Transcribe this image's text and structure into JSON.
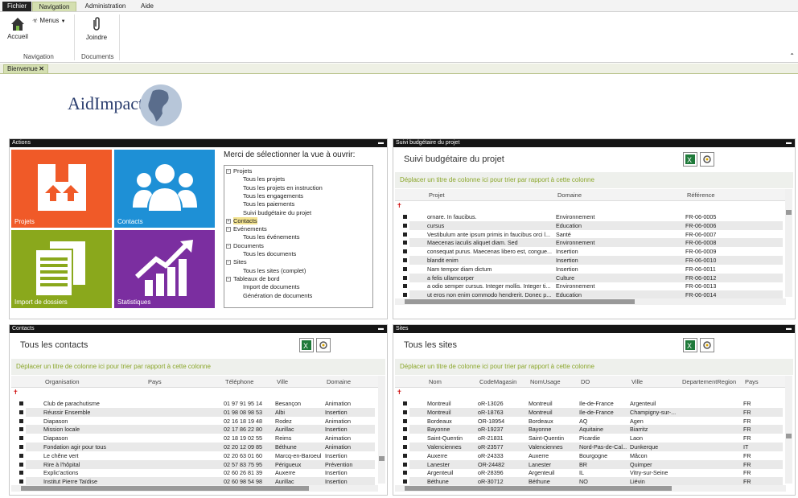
{
  "menu": {
    "file": "Fichier",
    "navigation": "Navigation",
    "administration": "Administration",
    "help": "Aide"
  },
  "ribbon": {
    "home": "Accueil",
    "menus": "Menus",
    "group_navigation": "Navigation",
    "attach": "Joindre",
    "group_documents": "Documents"
  },
  "doc_tab": {
    "label": "Bienvenue"
  },
  "logo": {
    "text": "AidImpact"
  },
  "actions": {
    "title": "Actions",
    "tiles": {
      "projects": "Projets",
      "contacts": "Contacts",
      "import": "Import de dossiers",
      "stats": "Statistiques"
    },
    "prompt": "Merci de sélectionner la vue à ouvrir:",
    "tree": [
      {
        "label": "Projets",
        "level": 0,
        "expand": "−"
      },
      {
        "label": "Tous les projets",
        "level": 1
      },
      {
        "label": "Tous les projets en instruction",
        "level": 1
      },
      {
        "label": "Tous les engagements",
        "level": 1
      },
      {
        "label": "Tous les paiements",
        "level": 1
      },
      {
        "label": "Suivi budgétaire du projet",
        "level": 1
      },
      {
        "label": "Contacts",
        "level": 0,
        "expand": "+",
        "selected": true
      },
      {
        "label": "Evénements",
        "level": 0,
        "expand": "−"
      },
      {
        "label": "Tous les événements",
        "level": 1
      },
      {
        "label": "Documents",
        "level": 0,
        "expand": "−"
      },
      {
        "label": "Tous les documents",
        "level": 1
      },
      {
        "label": "Sites",
        "level": 0,
        "expand": "−"
      },
      {
        "label": "Tous les sites (complet)",
        "level": 1
      },
      {
        "label": "Tableaux de bord",
        "level": 0,
        "expand": "−"
      },
      {
        "label": "Import de documents",
        "level": 1
      },
      {
        "label": "Génération de documents",
        "level": 1
      }
    ]
  },
  "group_hint": "Déplacer un titre de colonne ici pour trier par rapport à cette colonne",
  "budget": {
    "header": "Suivi budgétaire du projet",
    "title": "Suivi budgétaire du projet",
    "columns": [
      "Projet",
      "Domaine",
      "Référence"
    ],
    "rows": [
      [
        "ornare. In faucibus.",
        "Environnement",
        "FR-06-0005"
      ],
      [
        "cursus",
        "Education",
        "FR-06-0006"
      ],
      [
        "Vestibulum ante ipsum primis in faucibus orci l...",
        "Santé",
        "FR-06-0007"
      ],
      [
        "Maecenas iaculis aliquet diam. Sed",
        "Environnement",
        "FR-06-0008"
      ],
      [
        "consequat purus. Maecenas libero est, congue...",
        "Insertion",
        "FR-06-0009"
      ],
      [
        "blandit enim",
        "Insertion",
        "FR-06-0010"
      ],
      [
        "Nam tempor diam dictum",
        "Insertion",
        "FR-06-0011"
      ],
      [
        "a felis ullamcorper",
        "Culture",
        "FR-06-0012"
      ],
      [
        "a odio semper cursus. Integer mollis. Integer ti...",
        "Environnement",
        "FR-06-0013"
      ],
      [
        "ut eros non enim commodo hendrerit. Donec p...",
        "Education",
        "FR-06-0014"
      ]
    ]
  },
  "contacts": {
    "header": "Contacts",
    "title": "Tous les contacts",
    "columns": [
      "Organisation",
      "Pays",
      "Téléphone",
      "Ville",
      "Domaine"
    ],
    "rows": [
      [
        "Club de parachutisme",
        "",
        "01 97 91 95 14",
        "Besançon",
        "Animation"
      ],
      [
        "Réussir Ensemble",
        "",
        "01 98 08 98 53",
        "Albi",
        "Insertion"
      ],
      [
        "Diapason",
        "",
        "02 16 18 19 48",
        "Rodez",
        "Animation"
      ],
      [
        "Mission locale",
        "",
        "02 17 86 22 80",
        "Aurillac",
        "Insertion"
      ],
      [
        "Diapason",
        "",
        "02 18 19 02 55",
        "Reims",
        "Animation"
      ],
      [
        "Fondation agir pour tous",
        "",
        "02 20 12 09 85",
        "Béthune",
        "Animation"
      ],
      [
        "Le chêne vert",
        "",
        "02 20 63 01 60",
        "Marcq-en-Baroeul",
        "Insertion"
      ],
      [
        "Rire à l'hôpital",
        "",
        "02 57 83 75 95",
        "Périgueux",
        "Prévention"
      ],
      [
        "Explic'actions",
        "",
        "02 60 26 81 39",
        "Auxerre",
        "Insertion"
      ],
      [
        "Institut Pierre Taïdise",
        "",
        "02 60 98 54 98",
        "Aurillac",
        "Insertion"
      ]
    ]
  },
  "sites": {
    "header": "Sites",
    "title": "Tous les sites",
    "columns": [
      "Nom",
      "CodeMagasin",
      "NomUsage",
      "DO",
      "Ville",
      "DepartementRegion",
      "Pays"
    ],
    "rows": [
      [
        "Montreuil",
        "oR-13026",
        "Montreuil",
        "Ile-de-France",
        "Argenteuil",
        "",
        "FR"
      ],
      [
        "Montreuil",
        "oR-18763",
        "Montreuil",
        "Ile-de-France",
        "Champigny-sur-...",
        "",
        "FR"
      ],
      [
        "Bordeaux",
        "OR-18954",
        "Bordeaux",
        "AQ",
        "Agen",
        "",
        "FR"
      ],
      [
        "Bayonne",
        "oR-19237",
        "Bayonne",
        "Aquitaine",
        "Biarritz",
        "",
        "FR"
      ],
      [
        "Saint-Quentin",
        "oR-21831",
        "Saint-Quentin",
        "Picardie",
        "Laon",
        "",
        "FR"
      ],
      [
        "Valenciennes",
        "oR-23577",
        "Valenciennes",
        "Nord-Pas-de-Cal...",
        "Dunkerque",
        "",
        "IT"
      ],
      [
        "Auxerre",
        "oR-24333",
        "Auxerre",
        "Bourgogne",
        "Mâcon",
        "",
        "FR"
      ],
      [
        "Lanester",
        "OR-24482",
        "Lanester",
        "BR",
        "Quimper",
        "",
        "FR"
      ],
      [
        "Argenteuil",
        "oR-28396",
        "Argenteuil",
        "IL",
        "Vitry-sur-Seine",
        "",
        "FR"
      ],
      [
        "Béthune",
        "oR-30712",
        "Béthune",
        "NO",
        "Liévin",
        "",
        "FR"
      ]
    ]
  },
  "colors": {
    "tile_projects": "#f05a28",
    "tile_contacts": "#1e90d6",
    "tile_import": "#8aa81c",
    "tile_stats": "#7b2ea0",
    "accent": "#8aa62a"
  }
}
